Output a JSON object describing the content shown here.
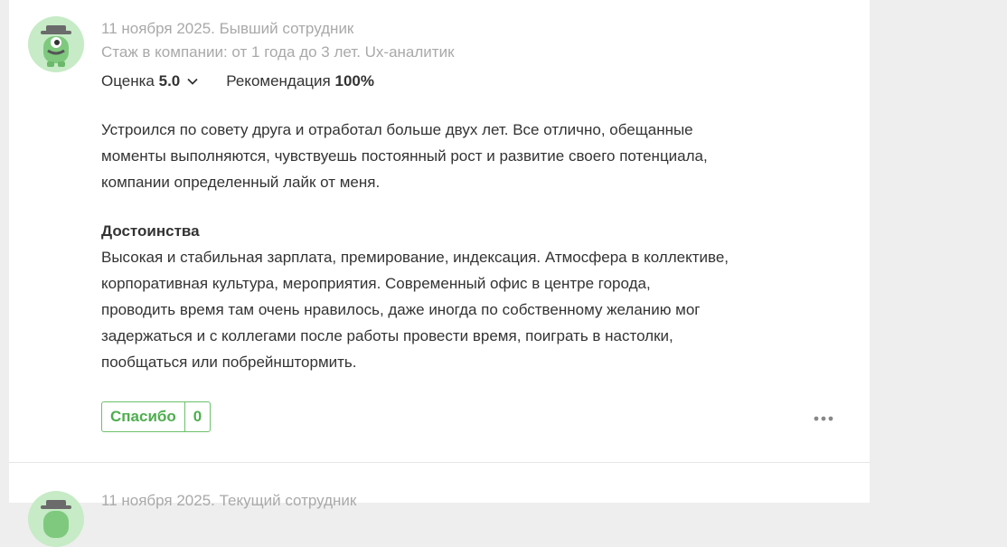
{
  "review1": {
    "avatar_icon": "ninja-avatar-icon",
    "date_status": "11 ноября 2025. Бывший сотрудник",
    "experience": "Стаж в компании: от 1 года до 3 лет. Ux-аналитик",
    "rating_label": "Оценка",
    "rating_value": "5.0",
    "recommend_label": "Рекомендация",
    "recommend_value": "100%",
    "body_lines": [
      "Устроился по совету друга и отработал больше двух лет. Все отлично, обещанные",
      "моменты выполняются, чувствуешь постоянный рост и развитие своего потенциала,",
      "компании определенный лайк от меня."
    ],
    "pros_title": "Достоинства",
    "pros_lines": [
      "Высокая и стабильная зарплата, премирование, индексация. Атмосфера в коллективе,",
      "корпоративная культура, мероприятия. Современный офис в центре города,",
      "проводить время там очень нравилось, даже иногда по собственному желанию мог",
      "задержаться и с коллегами после работы провести время, поиграть в настолки,",
      "пообщаться или побрейнштормить."
    ],
    "thanks_label": "Спасибо",
    "thanks_count": "0",
    "more_icon": "more-dots-icon"
  },
  "review2": {
    "date_status": "11 ноября 2025. Текущий сотрудник"
  },
  "colors": {
    "accent_green": "#4eae4e",
    "avatar_bg": "#c6ebc6",
    "meta_gray": "#a9a9a9"
  }
}
